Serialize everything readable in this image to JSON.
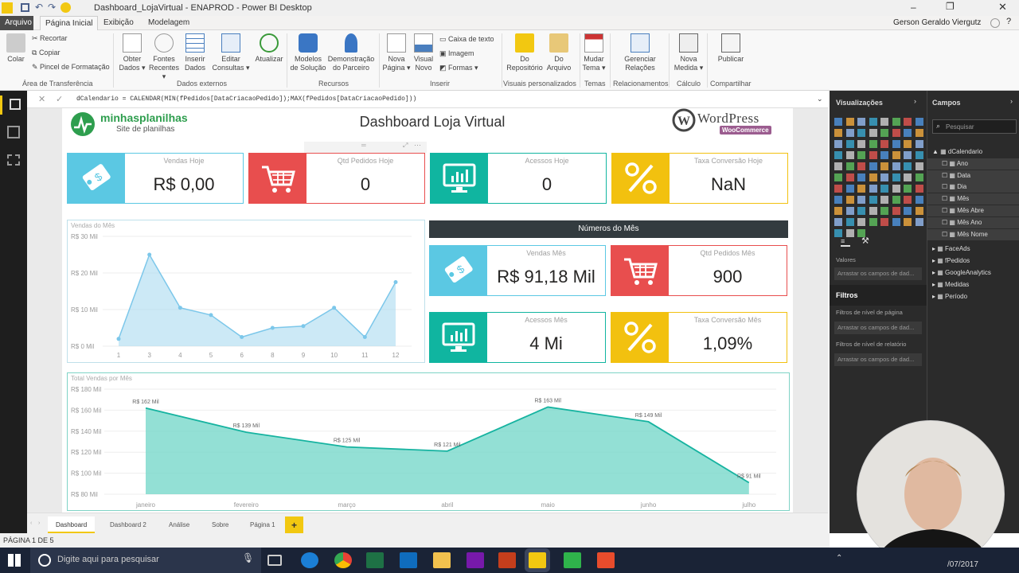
{
  "window": {
    "title": "Dashboard_LojaVirtual - ENAPROD - Power BI Desktop",
    "user": "Gerson Geraldo Viergutz"
  },
  "menu": {
    "file": "Arquivo",
    "home": "Página Inicial",
    "view": "Exibição",
    "modeling": "Modelagem"
  },
  "ribbon": {
    "paste": "Colar",
    "cut": "Recortar",
    "copy": "Copiar",
    "format_painter": "Pincel de Formatação",
    "get_data": "Obter Dados",
    "recent_sources": "Fontes Recentes",
    "enter_data": "Inserir Dados",
    "edit_queries": "Editar Consultas",
    "refresh": "Atualizar",
    "solution_templates": "Modelos de Solução",
    "partner_showcase": "Demonstração do Parceiro",
    "new_page": "Nova Página",
    "new_visual": "Visual Novo",
    "text_box": "Caixa de texto",
    "image": "Imagem",
    "shapes": "Formas",
    "from_store": "Do Repositório",
    "from_file": "Do Arquivo",
    "switch_theme": "Mudar Tema",
    "manage_relationships": "Gerenciar Relações",
    "new_measure": "Nova Medida",
    "publish": "Publicar",
    "groups": {
      "clipboard": "Área de Transferência",
      "external": "Dados externos",
      "resources": "Recursos",
      "insert": "Inserir",
      "custom_visuals": "Visuais personalizados",
      "themes": "Temas",
      "relationships": "Relacionamentos",
      "calculation": "Cálculo",
      "share": "Compartilhar"
    }
  },
  "formula": "dCalendario = CALENDAR(MIN(fPedidos[DataCriacaoPedido]);MAX(fPedidos[DataCriacaoPedido]))",
  "report": {
    "logo_main": "minhasplanilhas",
    "logo_sub": "Site de planilhas",
    "title": "Dashboard Loja Virtual",
    "wp_logo": "WordPress",
    "woo_logo": "WooCommerce",
    "kpis_today": [
      {
        "label": "Vendas Hoje",
        "value": "R$ 0,00",
        "color": "#5bc8e3",
        "icon": "price-tag-icon"
      },
      {
        "label": "Qtd Pedidos Hoje",
        "value": "0",
        "color": "#e84e4e",
        "icon": "cart-icon"
      },
      {
        "label": "Acessos Hoje",
        "value": "0",
        "color": "#10b5a0",
        "icon": "monitor-icon"
      },
      {
        "label": "Taxa Conversão Hoje",
        "value": "NaN",
        "color": "#f2c10f",
        "icon": "percent-icon"
      }
    ],
    "month_header": "Números do Mês",
    "kpis_month": [
      {
        "label": "Vendas Mês",
        "value": "R$ 91,18 Mil",
        "color": "#5bc8e3",
        "icon": "price-tag-icon"
      },
      {
        "label": "Qtd Pedidos Mês",
        "value": "900",
        "color": "#e84e4e",
        "icon": "cart-icon"
      },
      {
        "label": "Acessos Mês",
        "value": "4 Mi",
        "color": "#10b5a0",
        "icon": "monitor-icon"
      },
      {
        "label": "Taxa Conversão Mês",
        "value": "1,09%",
        "color": "#f2c10f",
        "icon": "percent-icon"
      }
    ]
  },
  "chart_data": [
    {
      "type": "area",
      "title": "Vendas do Mês",
      "x": [
        1,
        2,
        3,
        4,
        5,
        6,
        7,
        8,
        9,
        10,
        11,
        12
      ],
      "x_ticks": [
        "1",
        "3",
        "4",
        "5",
        "6",
        "8",
        "9",
        "10",
        "11",
        "12"
      ],
      "values": [
        2,
        25,
        10.5,
        8.5,
        2.5,
        5,
        5.5,
        10.5,
        2.5,
        17.5
      ],
      "y_ticks": [
        "R$ 0 Mil",
        "R$ 10 Mil",
        "R$ 20 Mil",
        "R$ 30 Mil"
      ],
      "ylim": [
        0,
        30
      ],
      "color": "#9ad4ee"
    },
    {
      "type": "area",
      "title": "Total Vendas por Mês",
      "categories": [
        "janeiro",
        "fevereiro",
        "março",
        "abril",
        "maio",
        "junho",
        "julho"
      ],
      "values": [
        162,
        139,
        125,
        121,
        163,
        149,
        91
      ],
      "data_labels": [
        "R$ 162 Mil",
        "R$ 139 Mil",
        "R$ 125 Mil",
        "R$ 121 Mil",
        "R$ 163 Mil",
        "R$ 149 Mil",
        "R$ 91 Mil"
      ],
      "y_ticks": [
        "R$ 80 Mil",
        "R$ 100 Mil",
        "R$ 120 Mil",
        "R$ 140 Mil",
        "R$ 160 Mil",
        "R$ 180 Mil"
      ],
      "ylim": [
        80,
        180
      ],
      "color": "#6fd6c7"
    }
  ],
  "visualizations_pane": {
    "title": "Visualizações",
    "values_label": "Valores",
    "drop_fields": "Arrastar os campos de dad...",
    "filters_title": "Filtros",
    "page_filters": "Filtros de nível de página",
    "report_filters": "Filtros de nível de relatório"
  },
  "fields_pane": {
    "title": "Campos",
    "search_placeholder": "Pesquisar",
    "tables": [
      "dCalendario",
      "FaceAds",
      "fPedidos",
      "GoogleAnalytics",
      "Medidas",
      "Período"
    ],
    "dcalendario_fields": [
      "Ano",
      "Data",
      "Dia",
      "Mês",
      "Mês Abre",
      "Mês Ano",
      "Mês Nome"
    ]
  },
  "page_tabs": [
    "Dashboard",
    "Dashboard 2",
    "Análise",
    "Sobre",
    "Página 1"
  ],
  "add_tab": "+",
  "status": "PÁGINA 1 DE 5",
  "taskbar": {
    "search": "Digite aqui para pesquisar",
    "date": "/07/2017"
  }
}
